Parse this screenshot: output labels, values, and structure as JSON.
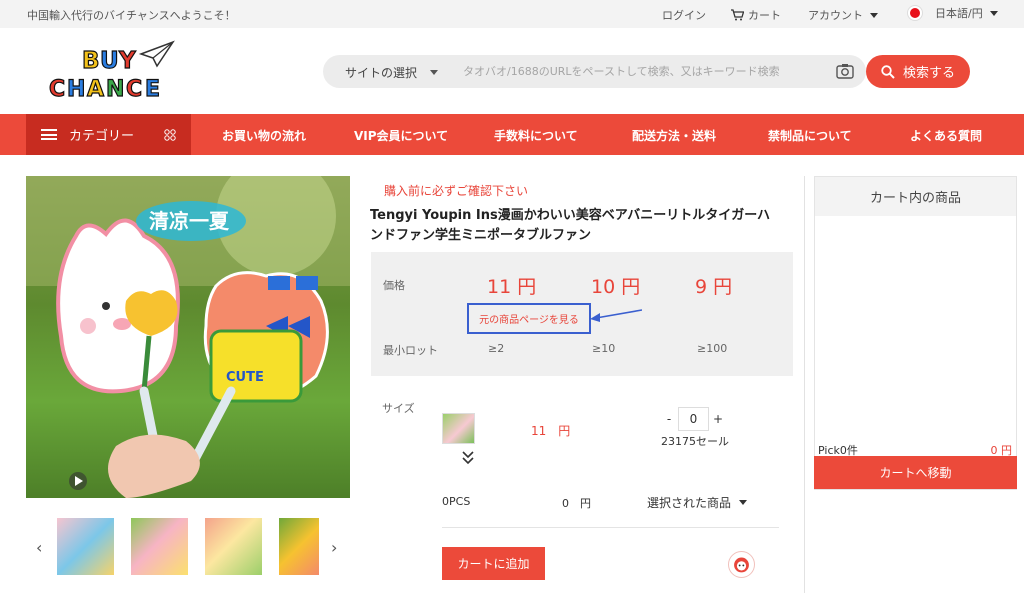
{
  "topbar": {
    "welcome": "中国輸入代行のバイチャンスへようこそ！",
    "login": "ログイン",
    "cart": "カート",
    "account": "アカウント",
    "language": "日本語/円"
  },
  "logo": {
    "text_line1": "BUY",
    "text_line2": "CHANCE"
  },
  "search": {
    "site_select": "サイトの選択",
    "placeholder": "タオバオ/1688のURLをペーストして検索、又はキーワード検索",
    "button": "検索する"
  },
  "nav": {
    "category": "カテゴリー",
    "items": [
      "お買い物の流れ",
      "VIP会員について",
      "手数料について",
      "配送方法・送料",
      "禁制品について",
      "よくある質問"
    ]
  },
  "product": {
    "notice": "購入前に必ずご確認下さい",
    "title": "Tengyi Youpin Ins漫画かわいい美容ベアバニーリトルタイガーハンドファン学生ミニポータブルファン",
    "price_label": "価格",
    "prices": [
      "11 円",
      "10 円",
      "9 円"
    ],
    "view_original": "元の商品ページを見る",
    "min_lot_label": "最小ロット",
    "lots": [
      "≥2",
      "≥10",
      "≥100"
    ],
    "image_text": {
      "banner": "清凉一夏",
      "badge": "CUTE"
    }
  },
  "variant": {
    "size_label": "サイズ",
    "price": "11　円",
    "quantity": "0",
    "minus": "-",
    "plus": "+",
    "stock": "23175セール"
  },
  "summary": {
    "pcs": "0PCS",
    "total": "0　円",
    "selected": "選択された商品",
    "add_to_cart": "カートに追加"
  },
  "cart_panel": {
    "title": "カート内の商品",
    "pick": "Pick0件",
    "pick_price": "0 円",
    "go_cart": "カートへ移動"
  },
  "colors": {
    "accent": "#ec4a3a",
    "accent_dark": "#c72c20",
    "price": "#e8453a",
    "highlight": "#3a5fcf"
  }
}
